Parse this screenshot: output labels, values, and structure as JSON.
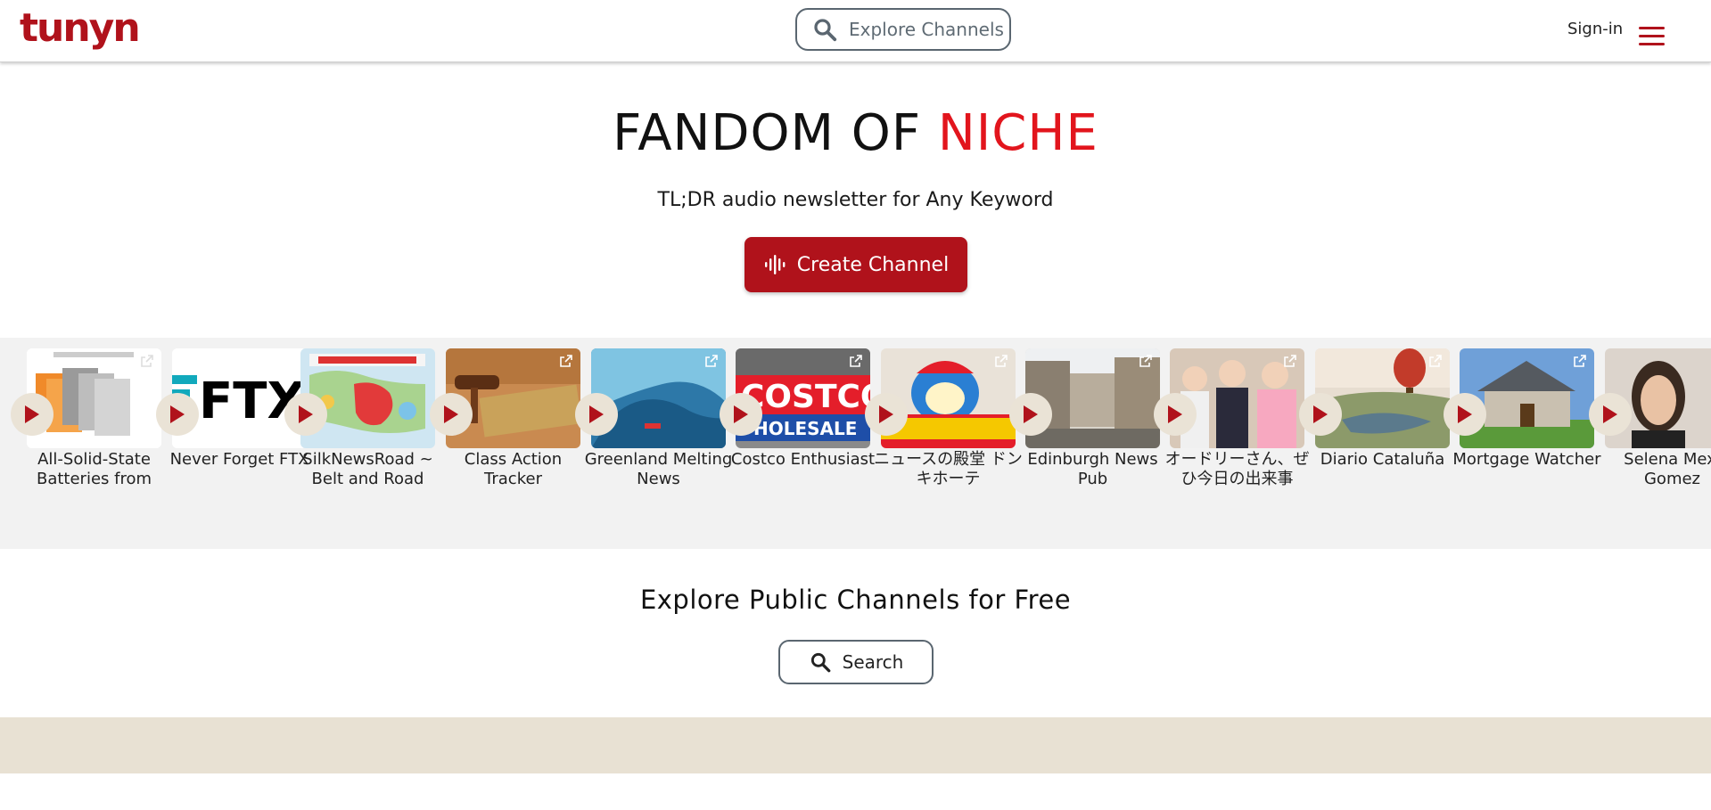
{
  "header": {
    "logo": "tunyn",
    "search_placeholder": "Explore Channels",
    "signin_label": "Sign-in"
  },
  "hero": {
    "title_main": "FANDOM OF ",
    "title_accent": "NICHE",
    "subtitle": "TL;DR audio newsletter for Any Keyword",
    "create_label": "Create Channel"
  },
  "channels": [
    {
      "label": "All-Solid-State Batteries from",
      "thumb": "battery-diagram"
    },
    {
      "label": "Never Forget FTX",
      "thumb": "ftx-logo"
    },
    {
      "label": "SilkNewsRoad ~ Belt and Road",
      "thumb": "belt-road-map"
    },
    {
      "label": "Class Action Tracker",
      "thumb": "gavel-plaque"
    },
    {
      "label": "Greenland Melting News",
      "thumb": "ice-cave"
    },
    {
      "label": "Costco Enthusiast",
      "thumb": "costco-sign"
    },
    {
      "label": "ニュースの殿堂 ドンキホーテ",
      "thumb": "donki-mascot"
    },
    {
      "label": "Edinburgh News Pub",
      "thumb": "city-street"
    },
    {
      "label": "オードリーさん、ぜひ今日の出来事",
      "thumb": "tv-hosts"
    },
    {
      "label": "Diario Cataluña",
      "thumb": "balloon-landscape"
    },
    {
      "label": "Mortgage Watcher",
      "thumb": "house"
    },
    {
      "label": "Selena Mexi Gomez",
      "thumb": "portrait"
    }
  ],
  "explore": {
    "title": "Explore Public Channels for Free",
    "search_label": "Search"
  },
  "colors": {
    "brand": "#b0121b",
    "accent": "#e2151d",
    "carousel_bg": "#f2f2f2",
    "footer_band": "#e8e1d3"
  }
}
